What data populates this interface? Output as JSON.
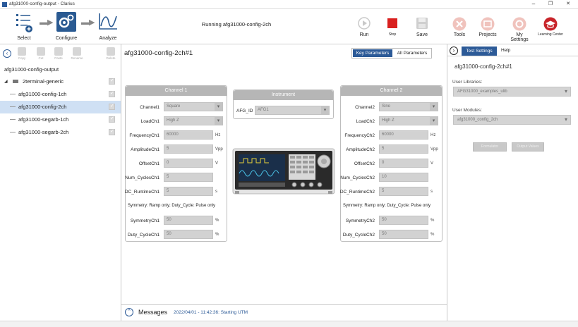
{
  "window": {
    "title": "afg31000-config-output - Clarius",
    "minimize": "–",
    "restore": "❐",
    "close": "✕"
  },
  "toolbar": {
    "select": "Select",
    "configure": "Configure",
    "analyze": "Analyze",
    "status": "Running afg31000-config-2ch",
    "run": "Run",
    "stop": "Stop",
    "save": "Save",
    "tools": "Tools",
    "projects": "Projects",
    "my_settings": "My Settings",
    "learning_center": "Learning Center",
    "stop_color": "#d9201f",
    "learning_color": "#c8242a"
  },
  "left": {
    "tools": [
      "Copy",
      "Cut",
      "Paste",
      "Rename",
      "Delete"
    ],
    "project": "afg31000-config-output",
    "tree": [
      {
        "label": "2terminal-generic",
        "level": 0
      },
      {
        "label": "afg31000-config-1ch",
        "level": 1
      },
      {
        "label": "afg31000-config-2ch",
        "level": 1,
        "selected": true
      },
      {
        "label": "afg31000-segarb-1ch",
        "level": 1
      },
      {
        "label": "afg31000-segarb-2ch",
        "level": 1
      }
    ]
  },
  "center": {
    "title": "afg31000-config-2ch#1",
    "tab_key": "Key Parameters",
    "tab_all": "All Parameters",
    "ch1": {
      "header": "Channel 1",
      "channel_label": "Channel1",
      "channel_value": "Square",
      "load_label": "LoadCh1",
      "load_value": "High Z",
      "freq_label": "FrequencyCh1",
      "freq_value": "60000",
      "freq_unit": "Hz",
      "amp_label": "AmplitudeCh1",
      "amp_value": "5",
      "amp_unit": "Vpp",
      "offset_label": "OffsetCh1",
      "offset_value": "0",
      "offset_unit": "V",
      "cycles_label": "Num_CyclesCh1",
      "cycles_value": "5",
      "runtime_label": "DC_RuntimeCh1",
      "runtime_value": "5",
      "runtime_unit": "s",
      "note": "Symmetry: Ramp only; Duty_Cycle: Pulse only",
      "sym_label": "SymmetryCh1",
      "sym_value": "50",
      "sym_unit": "%",
      "duty_label": "Duty_CycleCh1",
      "duty_value": "50",
      "duty_unit": "%"
    },
    "instrument": {
      "header": "Instrument",
      "id_label": "AFG_ID",
      "id_value": "AFG1"
    },
    "ch2": {
      "header": "Channel 2",
      "channel_label": "Channel2",
      "channel_value": "Sine",
      "load_label": "LoadCh2",
      "load_value": "High Z",
      "freq_label": "FrequencyCh2",
      "freq_value": "60000",
      "freq_unit": "Hz",
      "amp_label": "AmplitudeCh2",
      "amp_value": "5",
      "amp_unit": "Vpp",
      "offset_label": "OffsetCh2",
      "offset_value": "0",
      "offset_unit": "V",
      "cycles_label": "Num_CyclesCh2",
      "cycles_value": "10",
      "runtime_label": "DC_RuntimeCh2",
      "runtime_value": "5",
      "runtime_unit": "s",
      "note": "Symmetry: Ramp only; Duty_Cycle: Pulse only",
      "sym_label": "SymmetryCh2",
      "sym_value": "50",
      "sym_unit": "%",
      "duty_label": "Duty_CycleCh2",
      "duty_value": "50",
      "duty_unit": "%"
    },
    "messages": {
      "label": "Messages",
      "text": "2022/04/01 - 11:42:36: Starting UTM"
    }
  },
  "right": {
    "tab_settings": "Test Settings",
    "tab_help": "Help",
    "title": "afg31000-config-2ch#1",
    "libraries_label": "User Libraries:",
    "libraries_value": "AFG31000_examples_ulib",
    "modules_label": "User Modules:",
    "modules_value": "afg31000_config_2ch",
    "btn_formulator": "Formulator",
    "btn_output": "Output Values",
    "accent": "#2c5a97"
  }
}
